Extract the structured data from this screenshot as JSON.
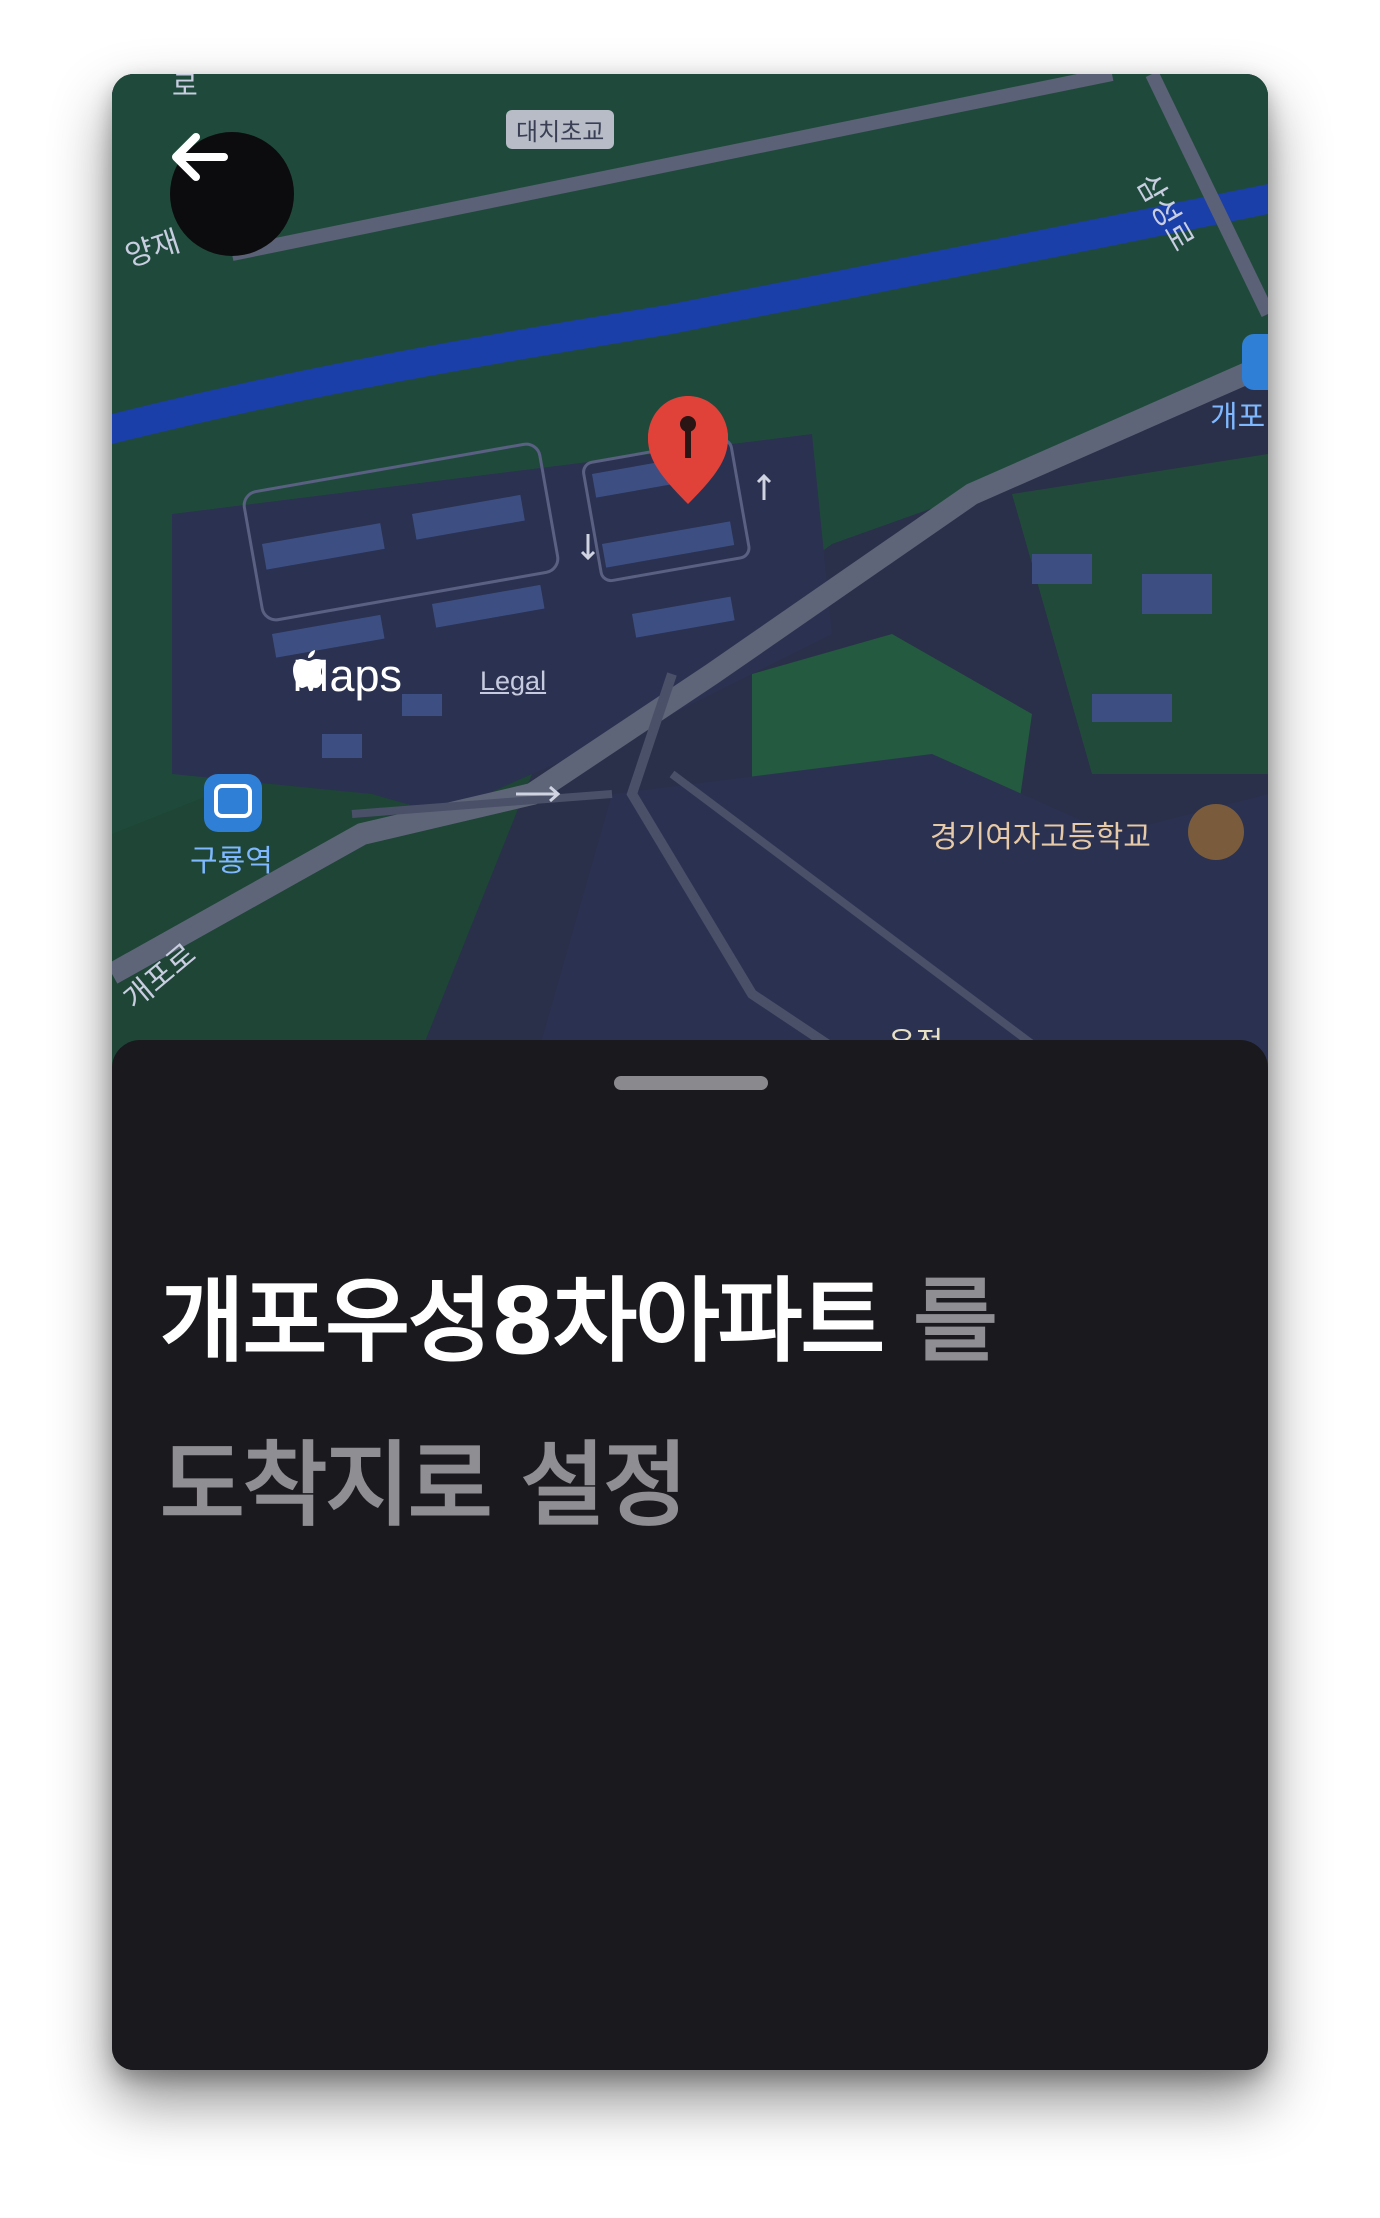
{
  "map": {
    "labels": {
      "top_road_partial": "로",
      "school_small": "대치초교",
      "road_samseong": "삼성로",
      "yangjae_partial": "양재",
      "gaepo_station_partial": "개포",
      "guryong_station": "구룡역",
      "gaepo_road": "개포로",
      "girls_high_school": "경기여자고등학교",
      "bottom_poi_partial": "우전"
    },
    "attribution": {
      "maps_wordmark": "Maps",
      "legal_link": "Legal"
    },
    "pin_color": "#e0423a",
    "background_color": "#2a2f4a",
    "green_area_color": "#1f4a3b",
    "water_color": "#1b3fa8"
  },
  "header": {
    "back_icon": "arrow-left-icon"
  },
  "sheet": {
    "place_name": "개포우성8차아파트",
    "particle": " 를",
    "action": "도착지로 설정"
  }
}
